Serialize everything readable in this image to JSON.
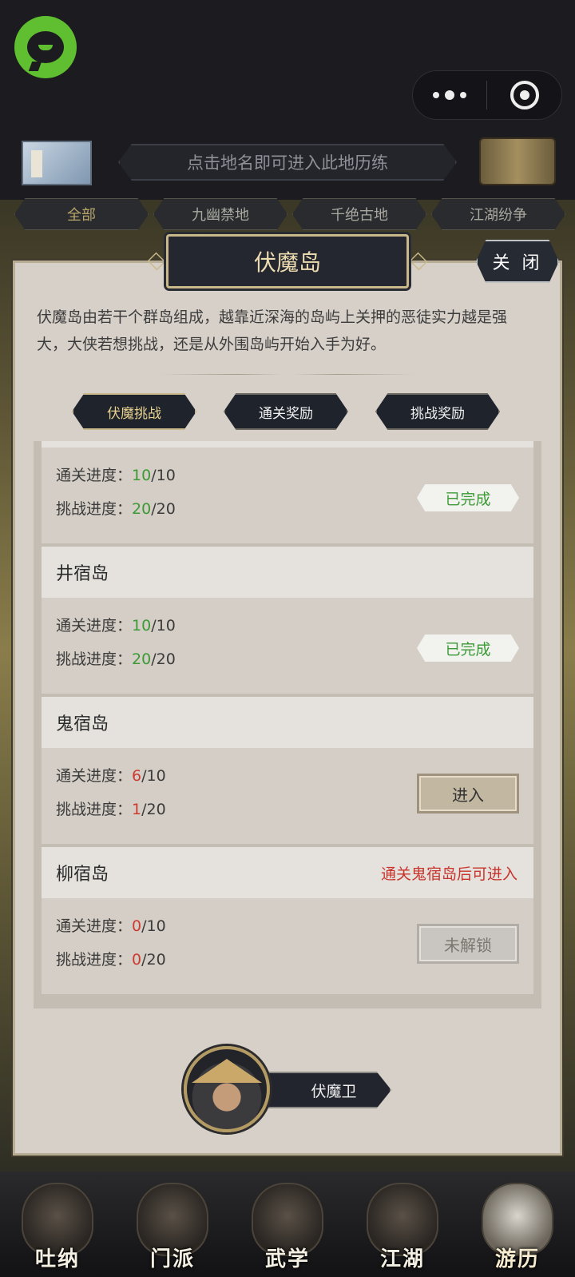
{
  "map_header": {
    "hint": "点击地名即可进入此地历练",
    "filters": [
      {
        "label": "全部",
        "active": true
      },
      {
        "label": "九幽禁地",
        "active": false
      },
      {
        "label": "千绝古地",
        "active": false
      },
      {
        "label": "江湖纷争",
        "active": false
      }
    ]
  },
  "panel": {
    "title": "伏魔岛",
    "close_label": "关 闭",
    "description": "伏魔岛由若干个群岛组成，越靠近深海的岛屿上关押的恶徒实力越是强大，大侠若想挑战，还是从外围岛屿开始入手为好。",
    "tabs": [
      {
        "label": "伏魔挑战",
        "active": true
      },
      {
        "label": "通关奖励",
        "active": false
      },
      {
        "label": "挑战奖励",
        "active": false
      }
    ]
  },
  "islands": [
    {
      "name": "",
      "lock_hint": "",
      "clear_label": "通关进度：",
      "clear_done": "10",
      "clear_total": "/10",
      "challenge_label": "挑战进度：",
      "challenge_done": "20",
      "challenge_total": "/20",
      "status": "已完成"
    },
    {
      "name": "井宿岛",
      "lock_hint": "",
      "clear_label": "通关进度：",
      "clear_done": "10",
      "clear_total": "/10",
      "challenge_label": "挑战进度：",
      "challenge_done": "20",
      "challenge_total": "/20",
      "status": "已完成"
    },
    {
      "name": "鬼宿岛",
      "lock_hint": "",
      "clear_label": "通关进度：",
      "clear_done": "6",
      "clear_total": "/10",
      "challenge_label": "挑战进度：",
      "challenge_done": "1",
      "challenge_total": "/20",
      "status": "进入"
    },
    {
      "name": "柳宿岛",
      "lock_hint": "通关鬼宿岛后可进入",
      "clear_label": "通关进度：",
      "clear_done": "0",
      "clear_total": "/10",
      "challenge_label": "挑战进度：",
      "challenge_done": "0",
      "challenge_total": "/20",
      "status": "未解锁"
    }
  ],
  "guard": {
    "name": "伏魔卫"
  },
  "bottom_nav": [
    {
      "label": "吐纳",
      "icon": "meditation-icon",
      "active": false
    },
    {
      "label": "门派",
      "icon": "sect-flag-icon",
      "active": false
    },
    {
      "label": "武学",
      "icon": "martial-book-icon",
      "active": false
    },
    {
      "label": "江湖",
      "icon": "straw-hat-icon",
      "active": false
    },
    {
      "label": "游历",
      "icon": "horse-icon",
      "active": true
    }
  ],
  "colors": {
    "progress_complete": "#3c9a36",
    "progress_incomplete": "#cf3a30",
    "lock_hint": "#c8342c",
    "title_gold": "#ecdcb0"
  }
}
